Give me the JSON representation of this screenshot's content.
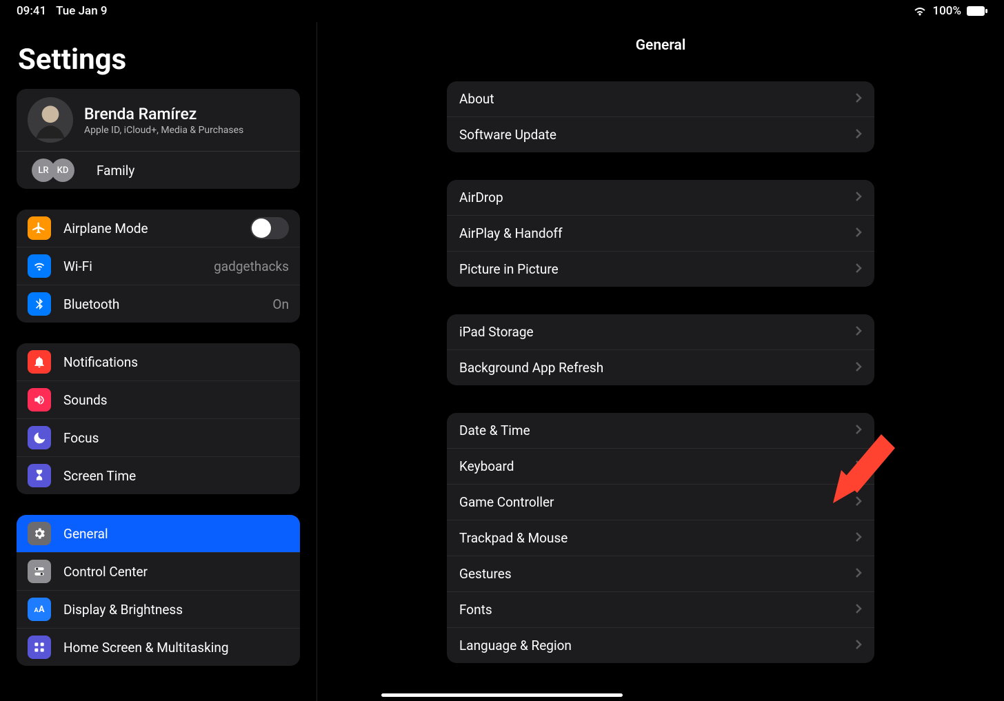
{
  "status": {
    "time": "09:41",
    "date": "Tue Jan 9",
    "battery": "100%"
  },
  "sidebar": {
    "title": "Settings",
    "profile": {
      "name": "Brenda Ramírez",
      "sub": "Apple ID, iCloud+, Media & Purchases",
      "family_label": "Family",
      "family_initials": [
        "LR",
        "KD"
      ]
    },
    "group_connectivity": {
      "airplane": "Airplane Mode",
      "wifi": "Wi-Fi",
      "wifi_value": "gadgethacks",
      "bluetooth": "Bluetooth",
      "bluetooth_value": "On"
    },
    "group_attention": {
      "notifications": "Notifications",
      "sounds": "Sounds",
      "focus": "Focus",
      "screentime": "Screen Time"
    },
    "group_device": {
      "general": "General",
      "control_center": "Control Center",
      "display": "Display & Brightness",
      "homescreen": "Home Screen & Multitasking"
    }
  },
  "content": {
    "title": "General",
    "groups": [
      [
        "About",
        "Software Update"
      ],
      [
        "AirDrop",
        "AirPlay & Handoff",
        "Picture in Picture"
      ],
      [
        "iPad Storage",
        "Background App Refresh"
      ],
      [
        "Date & Time",
        "Keyboard",
        "Game Controller",
        "Trackpad & Mouse",
        "Gestures",
        "Fonts",
        "Language & Region"
      ]
    ]
  },
  "annotation": {
    "target": "Game Controller"
  }
}
